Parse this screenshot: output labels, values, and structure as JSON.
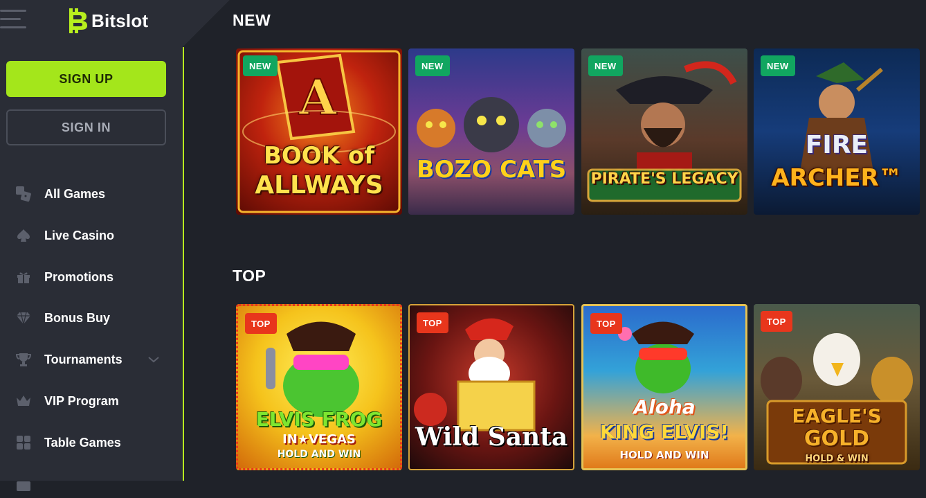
{
  "brand": {
    "name": "Bitslot"
  },
  "auth": {
    "signup_label": "SIGN UP",
    "signin_label": "SIGN IN"
  },
  "nav": {
    "items": [
      {
        "label": "All Games",
        "icon": "dice-icon"
      },
      {
        "label": "Live Casino",
        "icon": "spade-icon"
      },
      {
        "label": "Promotions",
        "icon": "gift-icon"
      },
      {
        "label": "Bonus Buy",
        "icon": "diamond-icon"
      },
      {
        "label": "Tournaments",
        "icon": "trophy-icon",
        "has_chevron": true
      },
      {
        "label": "VIP Program",
        "icon": "crown-icon"
      },
      {
        "label": "Table Games",
        "icon": "grid-icon"
      }
    ]
  },
  "sections": {
    "new": {
      "title": "NEW",
      "games": [
        {
          "name_line1": "BOOK of",
          "name_line2": "ALLWAYS",
          "badge": "NEW"
        },
        {
          "name_line1": "BOZO CATS",
          "name_line2": "",
          "badge": "NEW"
        },
        {
          "name_line1": "PIRATE'S LEGACY",
          "name_line2": "",
          "badge": "NEW"
        },
        {
          "name_line1": "FIRE",
          "name_line2": "ARCHER™",
          "badge": "NEW"
        }
      ]
    },
    "top": {
      "title": "TOP",
      "games": [
        {
          "name_line1": "ELVIS FROG",
          "name_line2": "IN★VEGAS",
          "name_line3": "HOLD AND WIN",
          "badge": "TOP"
        },
        {
          "name_line1": "Wild Santa",
          "name_line2": "",
          "name_line3": "",
          "badge": "TOP"
        },
        {
          "name_line1": "Aloha",
          "name_line2": "KING ELVIS!",
          "name_line3": "HOLD AND WIN",
          "badge": "TOP"
        },
        {
          "name_line1": "EAGLE'S",
          "name_line2": "GOLD",
          "name_line3": "HOLD & WIN",
          "badge": "TOP"
        }
      ]
    }
  },
  "colors": {
    "accent": "#a4e61b",
    "new_badge": "#11a660",
    "top_badge": "#e8361c",
    "sidebar_bg": "#2a2d36",
    "main_bg": "#1f2229"
  }
}
